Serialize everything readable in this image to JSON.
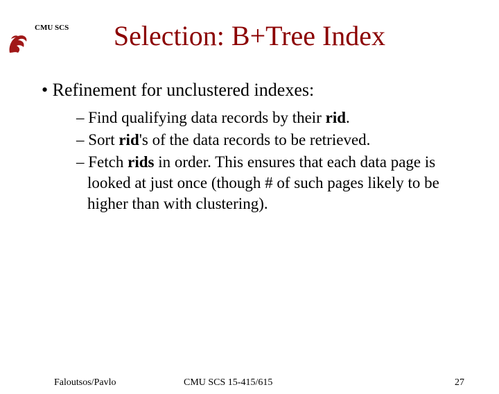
{
  "header": {
    "org_label": "CMU SCS"
  },
  "title": "Selection: B+Tree Index",
  "bullet": {
    "prefix": "• ",
    "text": "Refinement for unclustered indexes:"
  },
  "sub": {
    "item1_pre": "– Find qualifying data records by their ",
    "item1_bold": "rid",
    "item1_post": ".",
    "item2_pre": "– Sort ",
    "item2_bold": "rid",
    "item2_post": "'s of the data records to be retrieved.",
    "item3_pre": "– Fetch ",
    "item3_bold": "rids",
    "item3_post": " in order.  This ensures that each data page is looked at just once (though # of such pages likely to be higher than with clustering)."
  },
  "footer": {
    "left": "Faloutsos/Pavlo",
    "center": "CMU SCS 15-415/615",
    "page": "27"
  }
}
